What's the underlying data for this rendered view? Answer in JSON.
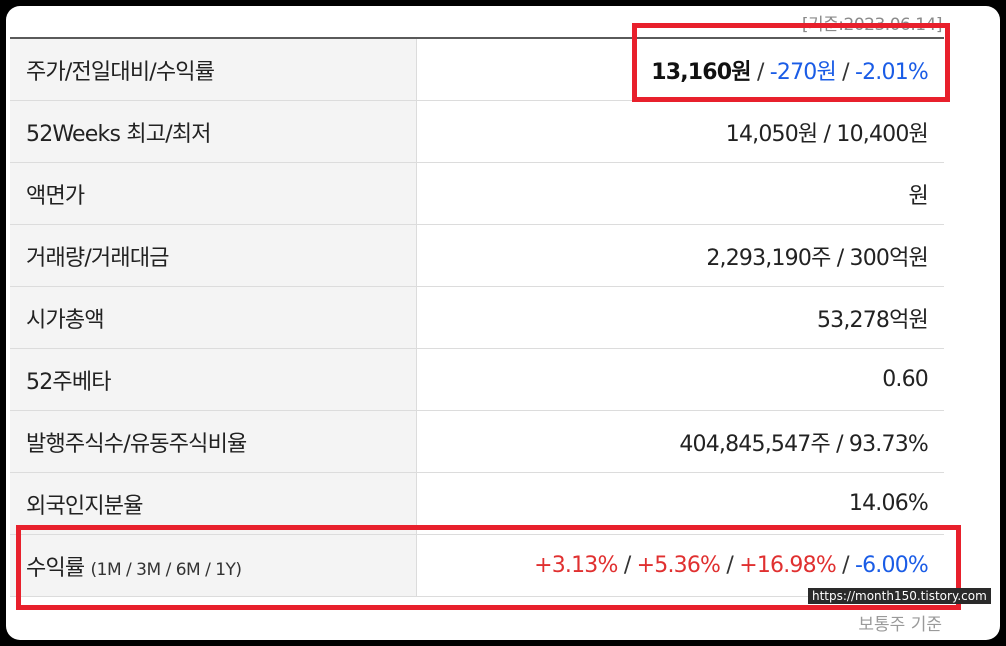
{
  "date_caption": "[기준:2023.06.14]",
  "rows": [
    {
      "label": "주가/전일대비/수익률",
      "price": "13,160원",
      "change": "-270원",
      "rate": "-2.01%"
    },
    {
      "label": "52Weeks 최고/최저",
      "value": "14,050원 / 10,400원"
    },
    {
      "label": "액면가",
      "value": "원"
    },
    {
      "label": "거래량/거래대금",
      "value": "2,293,190주 / 300억원"
    },
    {
      "label": "시가총액",
      "value": "53,278억원"
    },
    {
      "label": "52주베타",
      "value": "0.60"
    },
    {
      "label": "발행주식수/유동주식비율",
      "value": "404,845,547주 / 93.73%"
    },
    {
      "label": "외국인지분율",
      "value": "14.06%"
    },
    {
      "label": "수익률",
      "label_sub": "(1M / 3M / 6M / 1Y)",
      "r1m": "+3.13%",
      "r3m": "+5.36%",
      "r6m": "+16.98%",
      "r1y": "-6.00%"
    }
  ],
  "separator": "/",
  "watermark": "https://month150.tistory.com",
  "bottom_caption": "보통주 기준",
  "colors": {
    "highlight": "#e8202c",
    "positive": "#e03030",
    "negative": "#1a5ce6"
  }
}
